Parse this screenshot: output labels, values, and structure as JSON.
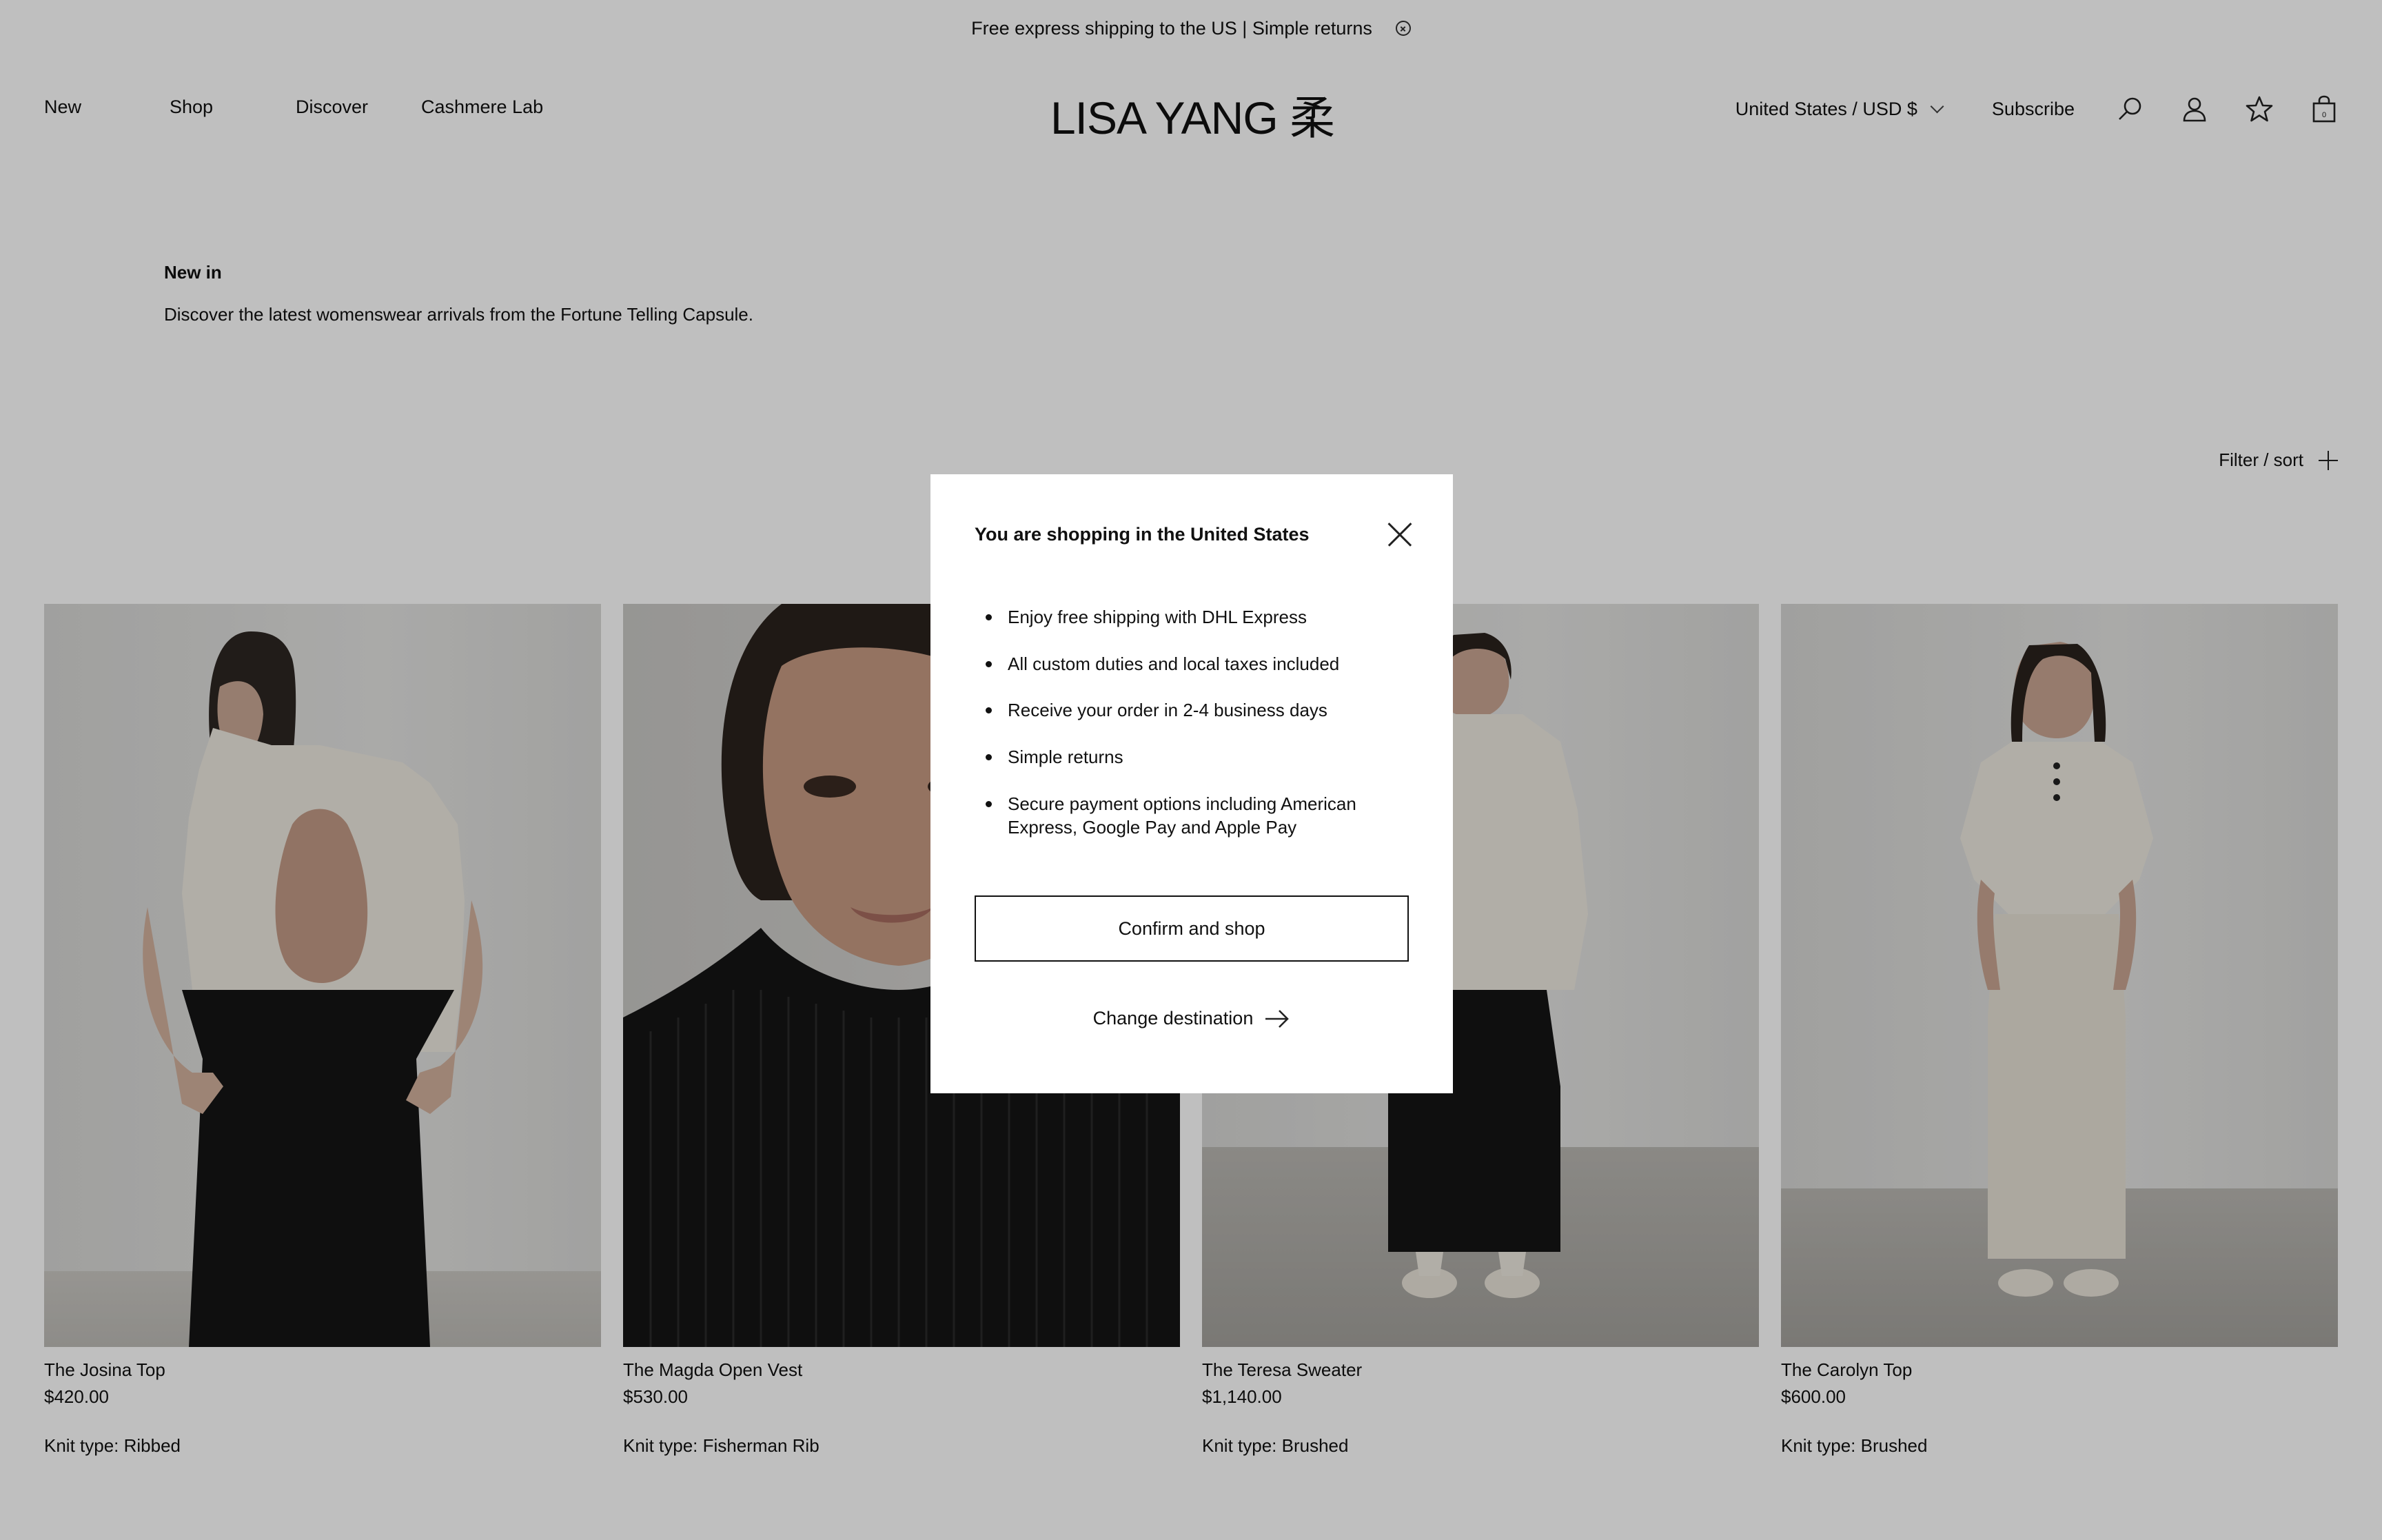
{
  "announcement": {
    "text": "Free express shipping to the US | Simple returns",
    "close_icon": "close-circle-icon"
  },
  "header": {
    "nav": [
      "New",
      "Shop",
      "Discover",
      "Cashmere Lab"
    ],
    "logo": "LISA YANG 柔",
    "locale": "United States / USD $",
    "subscribe": "Subscribe",
    "icons": [
      "search-icon",
      "account-icon",
      "wishlist-star-icon",
      "bag-icon"
    ],
    "bag_count": "0"
  },
  "intro": {
    "heading": "New in",
    "description": "Discover the latest womenswear arrivals from the Fortune Telling Capsule."
  },
  "filter": {
    "label": "Filter / sort"
  },
  "products": [
    {
      "name": "The Josina Top",
      "price": "$420.00",
      "knit": "Knit type: Ribbed"
    },
    {
      "name": "The Magda Open Vest",
      "price": "$530.00",
      "knit": "Knit type: Fisherman Rib"
    },
    {
      "name": "The Teresa Sweater",
      "price": "$1,140.00",
      "knit": "Knit type: Brushed"
    },
    {
      "name": "The Carolyn Top",
      "price": "$600.00",
      "knit": "Knit type: Brushed"
    }
  ],
  "modal": {
    "title": "You are shopping in the United States",
    "bullets": [
      "Enjoy free shipping with DHL Express",
      "All custom duties and local taxes included",
      "Receive your order in 2-4 business days",
      "Simple returns",
      "Secure payment options including American Express, Google Pay and Apple Pay"
    ],
    "confirm_label": "Confirm and shop",
    "change_label": "Change destination"
  },
  "colors": {
    "overlay": "rgba(0,0,0,0.25)",
    "modal_bg": "#ffffff",
    "text": "#111111"
  }
}
